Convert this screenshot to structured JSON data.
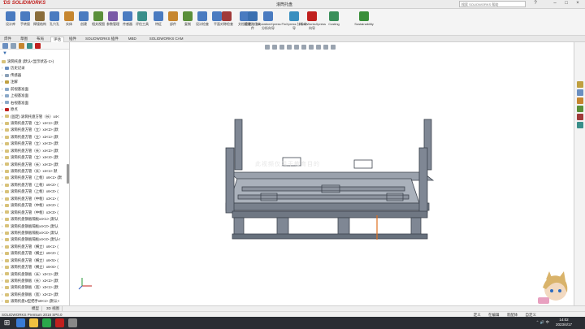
{
  "app": {
    "name": "SOLIDWORKS",
    "doc_title": "滚筒托盘",
    "search_placeholder": "搜索 SOLIDWORKS 帮助"
  },
  "ribbon": [
    {
      "label": "设计库",
      "color": "#4a7bc0"
    },
    {
      "label": "手转接",
      "color": "#4a7bc0"
    },
    {
      "label": "焊接结构",
      "color": "#8a6d3b"
    },
    {
      "label": "孔穴孔",
      "color": "#4a7bc0"
    },
    {
      "label": "实体",
      "color": "#c6862f"
    },
    {
      "label": "创建",
      "color": "#4a7bc0"
    },
    {
      "label": "相关视图",
      "color": "#5a8f3a"
    },
    {
      "label": "参数管理",
      "color": "#7a5aa6"
    },
    {
      "label": "传感器",
      "color": "#4a7bc0"
    },
    {
      "label": "评估工具",
      "color": "#3a8f8a"
    },
    {
      "label": "特征",
      "color": "#4a7bc0"
    },
    {
      "label": "部件",
      "color": "#c6862f"
    },
    {
      "label": "复制",
      "color": "#5a8f3a"
    },
    {
      "label": "设计检查",
      "color": "#4a7bc0"
    },
    {
      "label": "平面",
      "color": "#4a7bc0"
    },
    {
      "label": "对称检查",
      "color": "#a03a3a"
    },
    {
      "label": "文档管理",
      "color": "#4a7bc0"
    },
    {
      "label": "检查路径文件",
      "color": "#3a6fb0"
    },
    {
      "label": "SimulationXpress 分析向导",
      "color": "#4a7bc0"
    },
    {
      "label": "FloXpress 分析向导",
      "color": "#3a8fbf"
    },
    {
      "label": "DriveWorksXpress 向导",
      "color": "#c0201e"
    },
    {
      "label": "Costing",
      "color": "#3a8f5a"
    },
    {
      "label": "Sustainability",
      "color": "#3a8f3a"
    }
  ],
  "cmd_tabs": [
    "焊件",
    "草图",
    "布局",
    "评估",
    "插件",
    "SOLIDWORKS 插件",
    "MBD",
    "SOLIDWORKS CAM"
  ],
  "active_cmd_tab": "评估",
  "feature_tree": {
    "root": "滚筒托盘 (默认<显示状态-1>)",
    "items": [
      {
        "label": "历史记录",
        "icon": "history-icon",
        "color": "#6b8fc0"
      },
      {
        "label": "传感器",
        "icon": "sensor-icon",
        "color": "#8aa0b8"
      },
      {
        "label": "注解",
        "icon": "annotation-icon",
        "color": "#c0a040"
      },
      {
        "label": "前视基准面",
        "icon": "plane-icon",
        "color": "#8aa8c8"
      },
      {
        "label": "上视基准面",
        "icon": "plane-icon",
        "color": "#8aa8c8"
      },
      {
        "label": "右视基准面",
        "icon": "plane-icon",
        "color": "#8aa8c8"
      },
      {
        "label": "原点",
        "icon": "origin-icon",
        "color": "#c0201e"
      },
      {
        "label": "(固定) 滚筒托盘方管（长）x4<",
        "icon": "part-icon",
        "color": "#d8c27a"
      },
      {
        "label": "滚筒托盘方管（立）x4<1> (默",
        "icon": "part-icon",
        "color": "#d8c27a"
      },
      {
        "label": "滚筒托盘方管（立）x4<2> (默",
        "icon": "part-icon",
        "color": "#d8c27a"
      },
      {
        "label": "滚筒托盘方管（立）x2<1> (默",
        "icon": "part-icon",
        "color": "#d8c27a"
      },
      {
        "label": "滚筒托盘方管（立）x4<3> (默",
        "icon": "part-icon",
        "color": "#d8c27a"
      },
      {
        "label": "滚筒托盘方管（长）x4<2> (默",
        "icon": "part-icon",
        "color": "#d8c27a"
      },
      {
        "label": "滚筒托盘方管（立）x4<4> (默",
        "icon": "part-icon",
        "color": "#d8c27a"
      },
      {
        "label": "滚筒托盘方管（长）x4<3> (默",
        "icon": "part-icon",
        "color": "#d8c27a"
      },
      {
        "label": "滚筒托盘方管（长）x4<1> 默",
        "icon": "part-icon",
        "color": "#d8c27a"
      },
      {
        "label": "滚筒托盘方管（上框）x6<1> (默",
        "icon": "part-icon",
        "color": "#d8c27a"
      },
      {
        "label": "滚筒托盘方管（上框）x6<2> (",
        "icon": "part-icon",
        "color": "#d8c27a"
      },
      {
        "label": "滚筒托盘方管（上框）x6<3> (",
        "icon": "part-icon",
        "color": "#d8c27a"
      },
      {
        "label": "滚筒托盘方管（中框）x3<1> (",
        "icon": "part-icon",
        "color": "#d8c27a"
      },
      {
        "label": "滚筒托盘方管（中框）x3<2> (",
        "icon": "part-icon",
        "color": "#d8c27a"
      },
      {
        "label": "滚筒托盘方管（中框）x3<3> (",
        "icon": "part-icon",
        "color": "#d8c27a"
      },
      {
        "label": "滚筒托盘钢板隔板x4<1> (默认",
        "icon": "part-icon",
        "color": "#d8c27a"
      },
      {
        "label": "滚筒托盘钢板隔板x4<2> (默认",
        "icon": "part-icon",
        "color": "#d8c27a"
      },
      {
        "label": "滚筒托盘钢板隔板x4<3> (默认",
        "icon": "part-icon",
        "color": "#d8c27a"
      },
      {
        "label": "滚筒托盘钢板隔板x4<4> (默认<",
        "icon": "part-icon",
        "color": "#d8c27a"
      },
      {
        "label": "滚筒托盘方管（横立）x6<1> (",
        "icon": "part-icon",
        "color": "#d8c27a"
      },
      {
        "label": "滚筒托盘方管（横立）x6<2> (",
        "icon": "part-icon",
        "color": "#d8c27a"
      },
      {
        "label": "滚筒托盘方管（横立）x6<5> (",
        "icon": "part-icon",
        "color": "#d8c27a"
      },
      {
        "label": "滚筒托盘方管（横立）x6<6> (",
        "icon": "part-icon",
        "color": "#d8c27a"
      },
      {
        "label": "滚筒托盘钢板（长）x2<1> (默",
        "icon": "part-icon",
        "color": "#d8c27a"
      },
      {
        "label": "滚筒托盘钢板（长）x2<2> (默",
        "icon": "part-icon",
        "color": "#d8c27a"
      },
      {
        "label": "滚筒托盘钢板（宽）x2<1> (默",
        "icon": "part-icon",
        "color": "#d8c27a"
      },
      {
        "label": "滚筒托盘钢板（宽）x2<2> (默",
        "icon": "part-icon",
        "color": "#d8c27a"
      },
      {
        "label": "滚筒托盘U型把手x8<1> (默认<",
        "icon": "part-icon",
        "color": "#d8c27a"
      }
    ]
  },
  "bottom_tabs": [
    "模型",
    "3D 视图"
  ],
  "status": {
    "left": "SOLIDWORKS Premium 2018 SP0.0",
    "right": [
      "定义",
      "在编辑 装配体",
      "自定义"
    ]
  },
  "taskbar": {
    "time": "14:02",
    "date": "2023/4/17"
  },
  "viewport": {
    "watermark": "此视频仅用于教育目的"
  }
}
